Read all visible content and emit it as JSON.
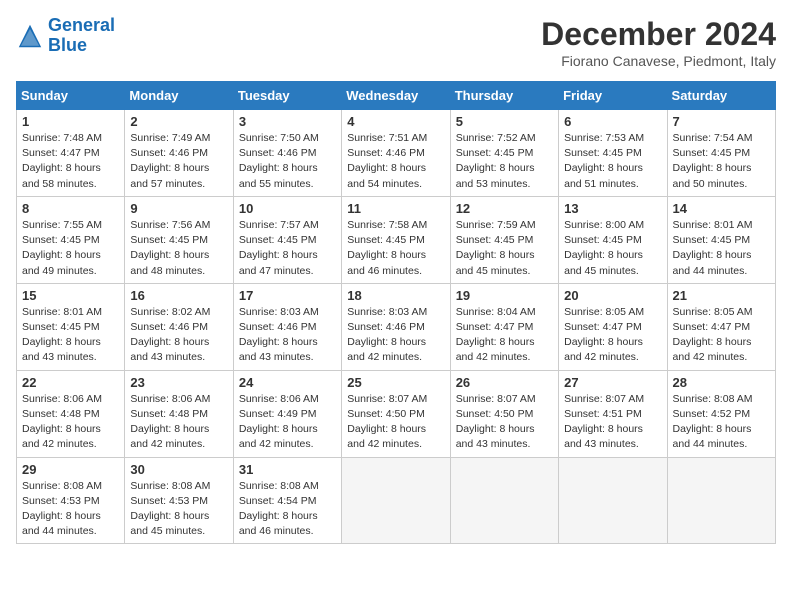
{
  "logo": {
    "line1": "General",
    "line2": "Blue"
  },
  "title": "December 2024",
  "subtitle": "Fiorano Canavese, Piedmont, Italy",
  "days_of_week": [
    "Sunday",
    "Monday",
    "Tuesday",
    "Wednesday",
    "Thursday",
    "Friday",
    "Saturday"
  ],
  "weeks": [
    [
      {
        "day": 1,
        "sunrise": "7:48 AM",
        "sunset": "4:47 PM",
        "daylight": "8 hours and 58 minutes."
      },
      {
        "day": 2,
        "sunrise": "7:49 AM",
        "sunset": "4:46 PM",
        "daylight": "8 hours and 57 minutes."
      },
      {
        "day": 3,
        "sunrise": "7:50 AM",
        "sunset": "4:46 PM",
        "daylight": "8 hours and 55 minutes."
      },
      {
        "day": 4,
        "sunrise": "7:51 AM",
        "sunset": "4:46 PM",
        "daylight": "8 hours and 54 minutes."
      },
      {
        "day": 5,
        "sunrise": "7:52 AM",
        "sunset": "4:45 PM",
        "daylight": "8 hours and 53 minutes."
      },
      {
        "day": 6,
        "sunrise": "7:53 AM",
        "sunset": "4:45 PM",
        "daylight": "8 hours and 51 minutes."
      },
      {
        "day": 7,
        "sunrise": "7:54 AM",
        "sunset": "4:45 PM",
        "daylight": "8 hours and 50 minutes."
      }
    ],
    [
      {
        "day": 8,
        "sunrise": "7:55 AM",
        "sunset": "4:45 PM",
        "daylight": "8 hours and 49 minutes."
      },
      {
        "day": 9,
        "sunrise": "7:56 AM",
        "sunset": "4:45 PM",
        "daylight": "8 hours and 48 minutes."
      },
      {
        "day": 10,
        "sunrise": "7:57 AM",
        "sunset": "4:45 PM",
        "daylight": "8 hours and 47 minutes."
      },
      {
        "day": 11,
        "sunrise": "7:58 AM",
        "sunset": "4:45 PM",
        "daylight": "8 hours and 46 minutes."
      },
      {
        "day": 12,
        "sunrise": "7:59 AM",
        "sunset": "4:45 PM",
        "daylight": "8 hours and 45 minutes."
      },
      {
        "day": 13,
        "sunrise": "8:00 AM",
        "sunset": "4:45 PM",
        "daylight": "8 hours and 45 minutes."
      },
      {
        "day": 14,
        "sunrise": "8:01 AM",
        "sunset": "4:45 PM",
        "daylight": "8 hours and 44 minutes."
      }
    ],
    [
      {
        "day": 15,
        "sunrise": "8:01 AM",
        "sunset": "4:45 PM",
        "daylight": "8 hours and 43 minutes."
      },
      {
        "day": 16,
        "sunrise": "8:02 AM",
        "sunset": "4:46 PM",
        "daylight": "8 hours and 43 minutes."
      },
      {
        "day": 17,
        "sunrise": "8:03 AM",
        "sunset": "4:46 PM",
        "daylight": "8 hours and 43 minutes."
      },
      {
        "day": 18,
        "sunrise": "8:03 AM",
        "sunset": "4:46 PM",
        "daylight": "8 hours and 42 minutes."
      },
      {
        "day": 19,
        "sunrise": "8:04 AM",
        "sunset": "4:47 PM",
        "daylight": "8 hours and 42 minutes."
      },
      {
        "day": 20,
        "sunrise": "8:05 AM",
        "sunset": "4:47 PM",
        "daylight": "8 hours and 42 minutes."
      },
      {
        "day": 21,
        "sunrise": "8:05 AM",
        "sunset": "4:47 PM",
        "daylight": "8 hours and 42 minutes."
      }
    ],
    [
      {
        "day": 22,
        "sunrise": "8:06 AM",
        "sunset": "4:48 PM",
        "daylight": "8 hours and 42 minutes."
      },
      {
        "day": 23,
        "sunrise": "8:06 AM",
        "sunset": "4:48 PM",
        "daylight": "8 hours and 42 minutes."
      },
      {
        "day": 24,
        "sunrise": "8:06 AM",
        "sunset": "4:49 PM",
        "daylight": "8 hours and 42 minutes."
      },
      {
        "day": 25,
        "sunrise": "8:07 AM",
        "sunset": "4:50 PM",
        "daylight": "8 hours and 42 minutes."
      },
      {
        "day": 26,
        "sunrise": "8:07 AM",
        "sunset": "4:50 PM",
        "daylight": "8 hours and 43 minutes."
      },
      {
        "day": 27,
        "sunrise": "8:07 AM",
        "sunset": "4:51 PM",
        "daylight": "8 hours and 43 minutes."
      },
      {
        "day": 28,
        "sunrise": "8:08 AM",
        "sunset": "4:52 PM",
        "daylight": "8 hours and 44 minutes."
      }
    ],
    [
      {
        "day": 29,
        "sunrise": "8:08 AM",
        "sunset": "4:53 PM",
        "daylight": "8 hours and 44 minutes."
      },
      {
        "day": 30,
        "sunrise": "8:08 AM",
        "sunset": "4:53 PM",
        "daylight": "8 hours and 45 minutes."
      },
      {
        "day": 31,
        "sunrise": "8:08 AM",
        "sunset": "4:54 PM",
        "daylight": "8 hours and 46 minutes."
      },
      null,
      null,
      null,
      null
    ]
  ]
}
